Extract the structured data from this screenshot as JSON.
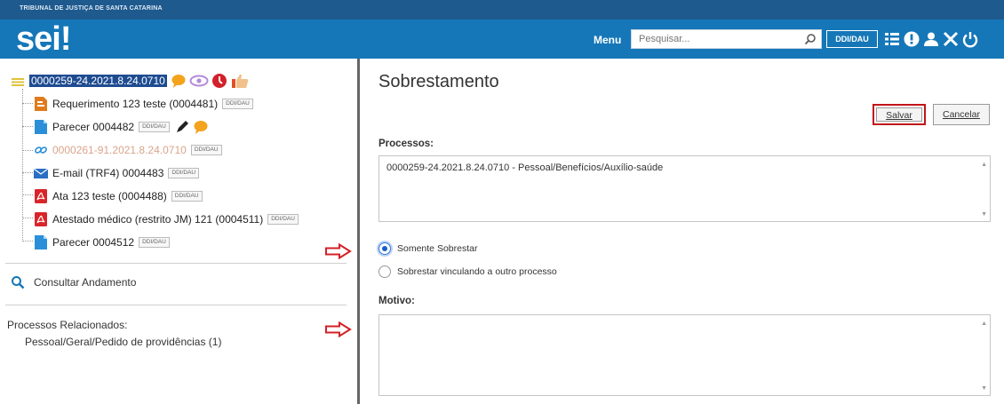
{
  "header": {
    "org": "TRIBUNAL DE JUSTIÇA DE SANTA CATARINA",
    "logo": "sei!",
    "menu_label": "Menu",
    "search_placeholder": "Pesquisar...",
    "unit": "DDI/DAU",
    "icons": [
      "search-icon",
      "grid-icon",
      "info-icon",
      "user-icon",
      "tools-icon",
      "power-icon"
    ]
  },
  "tree": {
    "root": "0000259-24.2021.8.24.0710",
    "root_icons": [
      "folder-icon",
      "comment-icon",
      "eye-icon",
      "clock-icon",
      "thumb-icon"
    ],
    "items": [
      {
        "label": "Requerimento 123 teste (0004481)",
        "badge": "DDI/DAU",
        "icon": "form-doc-icon"
      },
      {
        "label": "Parecer 0004482",
        "badge": "DDI/DAU",
        "icon": "doc-icon"
      },
      {
        "label": "0000261-91.2021.8.24.0710",
        "badge": "DDI/DAU",
        "icon": "link-icon"
      },
      {
        "label": "E-mail (TRF4) 0004483",
        "badge": "DDI/DAU",
        "icon": "email-icon"
      },
      {
        "label": "Ata 123 teste (0004488)",
        "badge": "DDI/DAU",
        "icon": "pdf-icon"
      },
      {
        "label": "Atestado médico (restrito JM) 121 (0004511)",
        "badge": "DDI/DAU",
        "icon": "pdf-icon"
      },
      {
        "label": "Parecer 0004512",
        "badge": "DDI/DAU",
        "icon": "doc-icon"
      }
    ]
  },
  "consult": "Consultar Andamento",
  "related": {
    "title": "Processos Relacionados:",
    "item": "Pessoal/Geral/Pedido de providências (1)"
  },
  "form": {
    "title": "Sobrestamento",
    "save": "Salvar",
    "cancel": "Cancelar",
    "processos_label": "Processos:",
    "processos_value": "0000259-24.2021.8.24.0710 - Pessoal/Benefícios/Auxílio-saúde",
    "radio1": "Somente Sobrestar",
    "radio2": "Sobrestar vinculando a outro processo",
    "radio_selected": "Somente Sobrestar",
    "motivo_label": "Motivo:",
    "motivo_value": ""
  },
  "colors": {
    "header": "#1577b8",
    "topbar": "#1e5a8e",
    "highlight": "#c0151b",
    "selected": "#1e4c91"
  }
}
